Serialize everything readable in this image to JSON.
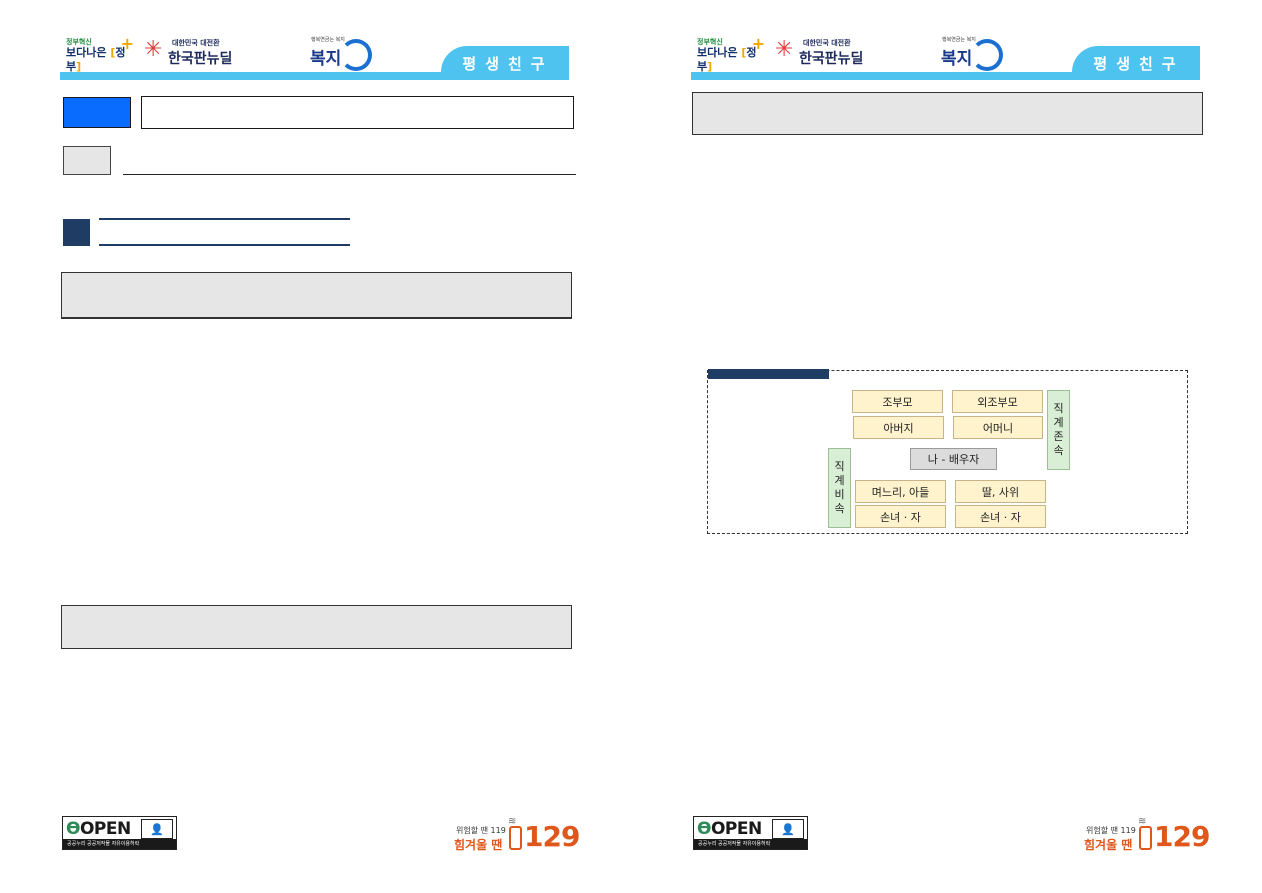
{
  "header": {
    "logo1_small": "정부혁신",
    "logo1_big_left": "보다나은",
    "logo1_big_right": "정부",
    "logo2_small": "대한민국 대전환",
    "logo2_big": "한국판뉴딜",
    "logo3_small": "행복연금는 복지",
    "logo3_big": "복지",
    "tab_label": "평생친구"
  },
  "footer": {
    "open_text": "OPEN",
    "open_badge": "출처표시",
    "open_strip": "공공누리  공공저작물 자유이용허락",
    "hotline_small": "위험할 땐 119",
    "hotline_big": "힘겨울 땐",
    "hotline_number": "129"
  },
  "diagram": {
    "row1": [
      "조부모",
      "외조부모"
    ],
    "row2": [
      "아버지",
      "어머니"
    ],
    "center": "나 - 배우자",
    "row3": [
      "며느리, 아들",
      "딸, 사위"
    ],
    "row4": [
      "손녀 · 자",
      "손녀 · 자"
    ],
    "ascend_label": "직계존속",
    "descend_label": "직계비속"
  },
  "colors": {
    "header_blue": "#4fc3f0",
    "title_tag_blue": "#0a6bff",
    "section_navy": "#1f3c64",
    "box_grey": "#e6e6e6",
    "family_yellow": "#fef3cd",
    "family_green": "#d8efd6"
  }
}
